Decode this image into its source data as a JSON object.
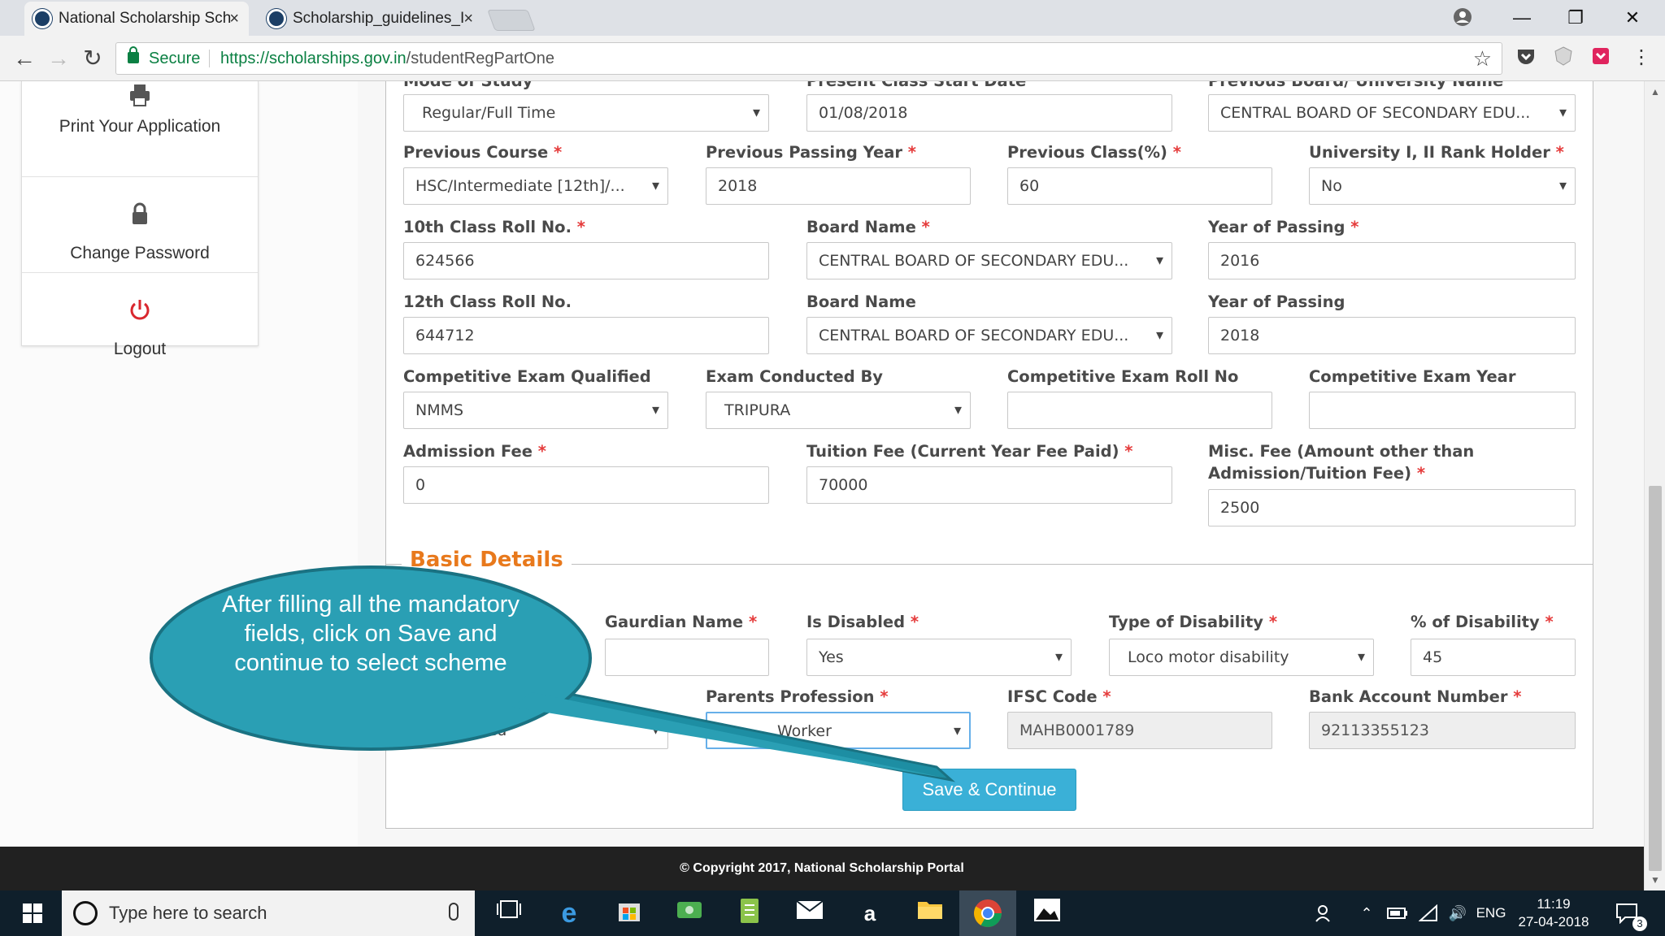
{
  "browser": {
    "tabs": [
      {
        "title": "National Scholarship Sch",
        "active": true
      },
      {
        "title": "Scholarship_guidelines_I",
        "active": false
      }
    ],
    "tab_close_glyph": "×",
    "secure_label": "Secure",
    "url_host": "https://scholarships.gov.in",
    "url_path": "/studentRegPartOne",
    "window_controls": {
      "minimize": "—",
      "restore": "❐",
      "close": "✕"
    }
  },
  "sidebar": {
    "items": [
      {
        "label": "Print Your Application",
        "icon": "printer-icon"
      },
      {
        "label": "Change Password",
        "icon": "lock-icon"
      },
      {
        "label": "Logout",
        "icon": "power-icon"
      }
    ]
  },
  "academic": {
    "row0": {
      "mode_of_study": {
        "label": "Mode of Study",
        "value": "Regular/Full Time"
      },
      "present_class_start": {
        "label": "Present Class Start Date",
        "value": "01/08/2018"
      },
      "previous_board": {
        "label": "Previous Board/ University Name",
        "value": "CENTRAL BOARD OF SECONDARY EDU..."
      }
    },
    "previous_course": {
      "label": "Previous Course",
      "value": "HSC/Intermediate [12th]/..."
    },
    "previous_passing_year": {
      "label": "Previous Passing Year",
      "value": "2018"
    },
    "previous_class_pct": {
      "label": "Previous Class(%)",
      "value": "60"
    },
    "rank_holder": {
      "label": "University I, II Rank Holder",
      "value": "No"
    },
    "roll10": {
      "label": "10th Class Roll No.",
      "value": "624566"
    },
    "board10": {
      "label": "Board Name",
      "value": "CENTRAL BOARD OF SECONDARY EDU..."
    },
    "year10": {
      "label": "Year of Passing",
      "value": "2016"
    },
    "roll12": {
      "label": "12th Class Roll No.",
      "value": "644712"
    },
    "board12": {
      "label": "Board Name",
      "value": "CENTRAL BOARD OF SECONDARY EDU..."
    },
    "year12": {
      "label": "Year of Passing",
      "value": "2018"
    },
    "comp_exam": {
      "label": "Competitive Exam Qualified",
      "value": "NMMS"
    },
    "exam_by": {
      "label": "Exam Conducted By",
      "value": "TRIPURA"
    },
    "comp_roll": {
      "label": "Competitive Exam Roll No",
      "value": ""
    },
    "comp_year": {
      "label": "Competitive Exam Year",
      "value": ""
    },
    "admission_fee": {
      "label": "Admission Fee",
      "value": "0"
    },
    "tuition_fee": {
      "label": "Tuition Fee (Current Year Fee Paid)",
      "value": "70000"
    },
    "misc_fee": {
      "label": "Misc. Fee (Amount other than Admission/Tuition Fee)",
      "value": "2500"
    }
  },
  "basic": {
    "legend": "Basic Details",
    "guardian_name": {
      "label": "Gaurdian Name",
      "value": ""
    },
    "is_disabled": {
      "label": "Is Disabled",
      "value": "Yes"
    },
    "type_disability": {
      "label": "Type of Disability",
      "value": "Loco motor disability"
    },
    "pct_disability": {
      "label": "% of Disability",
      "value": "45"
    },
    "marital_status": {
      "value": "Un Married"
    },
    "parents_profession": {
      "label": "Parents Profession",
      "value": "Worker"
    },
    "ifsc": {
      "label": "IFSC Code",
      "value": "MAHB0001789"
    },
    "bank_account": {
      "label": "Bank Account Number",
      "value": "92113355123"
    },
    "required_marker": "*"
  },
  "save_button": "Save & Continue",
  "callout": "After filling all the mandatory fields, click on Save and continue to select scheme",
  "footer": "© Copyright 2017, National Scholarship Portal",
  "taskbar": {
    "search_placeholder": "Type here to search",
    "language": "ENG",
    "time": "11:19",
    "date": "27-04-2018",
    "notification_count": "3"
  },
  "colors": {
    "legend_orange": "#e8791c",
    "button_blue": "#3ab0d7",
    "callout_teal": "#2a9fb4",
    "required_red": "#e53b3b",
    "secure_green": "#0b8043"
  }
}
